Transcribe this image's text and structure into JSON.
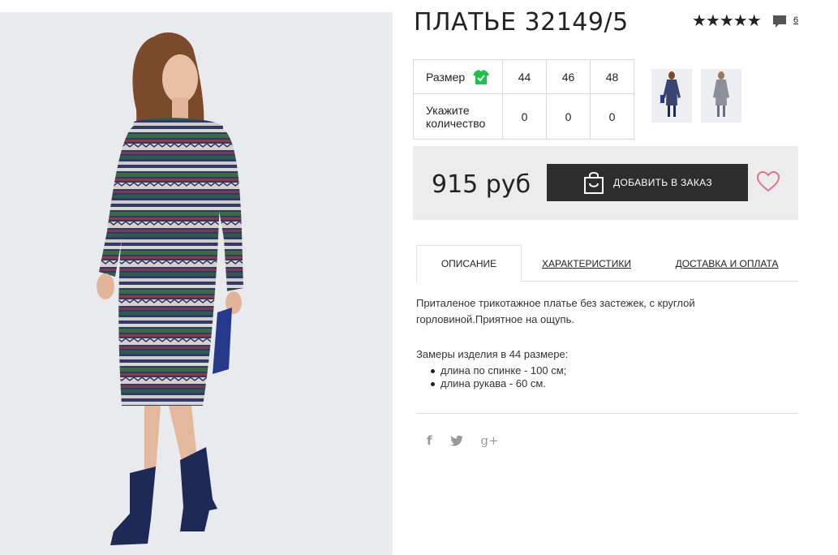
{
  "product": {
    "title": "ПЛАТЬЕ 32149/5",
    "rating_stars": "★★★★★",
    "rating_value": 5,
    "comments_count": "6"
  },
  "sizes": {
    "size_label": "Размер",
    "qty_label_1": "Укажите",
    "qty_label_2": "количество",
    "values": [
      "44",
      "46",
      "48"
    ],
    "quantities": [
      "0",
      "0",
      "0"
    ]
  },
  "purchase": {
    "price": "915 руб",
    "add_button": "ДОБАВИТЬ В ЗАКАЗ"
  },
  "tabs": [
    "ОПИСАНИЕ",
    "ХАРАКТЕРИСТИКИ",
    "ДОСТАВКА И ОПЛАТА"
  ],
  "description": {
    "text": "Приталеное трикотажное платье без застежек, с круглой горловиной.Приятное на ощупь.",
    "measure_title": "Замеры изделия в 44 размере:",
    "measures": [
      "длина по спинке - 100 см;",
      "длина рукава - 60 см."
    ]
  },
  "social": {
    "facebook": "f",
    "twitter": "twitter-icon",
    "googleplus": "g+"
  },
  "colors": {
    "button_bg": "#2d2d2d",
    "heart": "#e5708a",
    "check_icon": "#1fc14a",
    "price_box": "#ececec"
  }
}
